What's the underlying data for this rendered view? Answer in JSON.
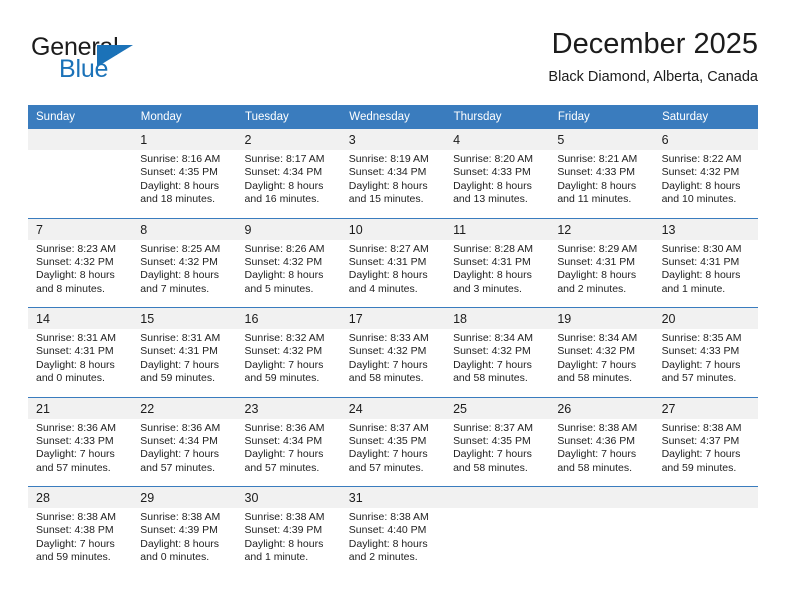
{
  "brand": {
    "name_part1": "General",
    "name_part2": "Blue",
    "accent_color": "#1b72b8"
  },
  "header": {
    "title": "December 2025",
    "location": "Black Diamond, Alberta, Canada"
  },
  "calendar": {
    "header_bg": "#3a7cbe",
    "weekdays": [
      "Sunday",
      "Monday",
      "Tuesday",
      "Wednesday",
      "Thursday",
      "Friday",
      "Saturday"
    ],
    "weeks": [
      [
        {
          "day": "",
          "lines": []
        },
        {
          "day": "1",
          "lines": [
            "Sunrise: 8:16 AM",
            "Sunset: 4:35 PM",
            "Daylight: 8 hours",
            "and 18 minutes."
          ]
        },
        {
          "day": "2",
          "lines": [
            "Sunrise: 8:17 AM",
            "Sunset: 4:34 PM",
            "Daylight: 8 hours",
            "and 16 minutes."
          ]
        },
        {
          "day": "3",
          "lines": [
            "Sunrise: 8:19 AM",
            "Sunset: 4:34 PM",
            "Daylight: 8 hours",
            "and 15 minutes."
          ]
        },
        {
          "day": "4",
          "lines": [
            "Sunrise: 8:20 AM",
            "Sunset: 4:33 PM",
            "Daylight: 8 hours",
            "and 13 minutes."
          ]
        },
        {
          "day": "5",
          "lines": [
            "Sunrise: 8:21 AM",
            "Sunset: 4:33 PM",
            "Daylight: 8 hours",
            "and 11 minutes."
          ]
        },
        {
          "day": "6",
          "lines": [
            "Sunrise: 8:22 AM",
            "Sunset: 4:32 PM",
            "Daylight: 8 hours",
            "and 10 minutes."
          ]
        }
      ],
      [
        {
          "day": "7",
          "lines": [
            "Sunrise: 8:23 AM",
            "Sunset: 4:32 PM",
            "Daylight: 8 hours",
            "and 8 minutes."
          ]
        },
        {
          "day": "8",
          "lines": [
            "Sunrise: 8:25 AM",
            "Sunset: 4:32 PM",
            "Daylight: 8 hours",
            "and 7 minutes."
          ]
        },
        {
          "day": "9",
          "lines": [
            "Sunrise: 8:26 AM",
            "Sunset: 4:32 PM",
            "Daylight: 8 hours",
            "and 5 minutes."
          ]
        },
        {
          "day": "10",
          "lines": [
            "Sunrise: 8:27 AM",
            "Sunset: 4:31 PM",
            "Daylight: 8 hours",
            "and 4 minutes."
          ]
        },
        {
          "day": "11",
          "lines": [
            "Sunrise: 8:28 AM",
            "Sunset: 4:31 PM",
            "Daylight: 8 hours",
            "and 3 minutes."
          ]
        },
        {
          "day": "12",
          "lines": [
            "Sunrise: 8:29 AM",
            "Sunset: 4:31 PM",
            "Daylight: 8 hours",
            "and 2 minutes."
          ]
        },
        {
          "day": "13",
          "lines": [
            "Sunrise: 8:30 AM",
            "Sunset: 4:31 PM",
            "Daylight: 8 hours",
            "and 1 minute."
          ]
        }
      ],
      [
        {
          "day": "14",
          "lines": [
            "Sunrise: 8:31 AM",
            "Sunset: 4:31 PM",
            "Daylight: 8 hours",
            "and 0 minutes."
          ]
        },
        {
          "day": "15",
          "lines": [
            "Sunrise: 8:31 AM",
            "Sunset: 4:31 PM",
            "Daylight: 7 hours",
            "and 59 minutes."
          ]
        },
        {
          "day": "16",
          "lines": [
            "Sunrise: 8:32 AM",
            "Sunset: 4:32 PM",
            "Daylight: 7 hours",
            "and 59 minutes."
          ]
        },
        {
          "day": "17",
          "lines": [
            "Sunrise: 8:33 AM",
            "Sunset: 4:32 PM",
            "Daylight: 7 hours",
            "and 58 minutes."
          ]
        },
        {
          "day": "18",
          "lines": [
            "Sunrise: 8:34 AM",
            "Sunset: 4:32 PM",
            "Daylight: 7 hours",
            "and 58 minutes."
          ]
        },
        {
          "day": "19",
          "lines": [
            "Sunrise: 8:34 AM",
            "Sunset: 4:32 PM",
            "Daylight: 7 hours",
            "and 58 minutes."
          ]
        },
        {
          "day": "20",
          "lines": [
            "Sunrise: 8:35 AM",
            "Sunset: 4:33 PM",
            "Daylight: 7 hours",
            "and 57 minutes."
          ]
        }
      ],
      [
        {
          "day": "21",
          "lines": [
            "Sunrise: 8:36 AM",
            "Sunset: 4:33 PM",
            "Daylight: 7 hours",
            "and 57 minutes."
          ]
        },
        {
          "day": "22",
          "lines": [
            "Sunrise: 8:36 AM",
            "Sunset: 4:34 PM",
            "Daylight: 7 hours",
            "and 57 minutes."
          ]
        },
        {
          "day": "23",
          "lines": [
            "Sunrise: 8:36 AM",
            "Sunset: 4:34 PM",
            "Daylight: 7 hours",
            "and 57 minutes."
          ]
        },
        {
          "day": "24",
          "lines": [
            "Sunrise: 8:37 AM",
            "Sunset: 4:35 PM",
            "Daylight: 7 hours",
            "and 57 minutes."
          ]
        },
        {
          "day": "25",
          "lines": [
            "Sunrise: 8:37 AM",
            "Sunset: 4:35 PM",
            "Daylight: 7 hours",
            "and 58 minutes."
          ]
        },
        {
          "day": "26",
          "lines": [
            "Sunrise: 8:38 AM",
            "Sunset: 4:36 PM",
            "Daylight: 7 hours",
            "and 58 minutes."
          ]
        },
        {
          "day": "27",
          "lines": [
            "Sunrise: 8:38 AM",
            "Sunset: 4:37 PM",
            "Daylight: 7 hours",
            "and 59 minutes."
          ]
        }
      ],
      [
        {
          "day": "28",
          "lines": [
            "Sunrise: 8:38 AM",
            "Sunset: 4:38 PM",
            "Daylight: 7 hours",
            "and 59 minutes."
          ]
        },
        {
          "day": "29",
          "lines": [
            "Sunrise: 8:38 AM",
            "Sunset: 4:39 PM",
            "Daylight: 8 hours",
            "and 0 minutes."
          ]
        },
        {
          "day": "30",
          "lines": [
            "Sunrise: 8:38 AM",
            "Sunset: 4:39 PM",
            "Daylight: 8 hours",
            "and 1 minute."
          ]
        },
        {
          "day": "31",
          "lines": [
            "Sunrise: 8:38 AM",
            "Sunset: 4:40 PM",
            "Daylight: 8 hours",
            "and 2 minutes."
          ]
        },
        {
          "day": "",
          "lines": []
        },
        {
          "day": "",
          "lines": []
        },
        {
          "day": "",
          "lines": []
        }
      ]
    ]
  }
}
